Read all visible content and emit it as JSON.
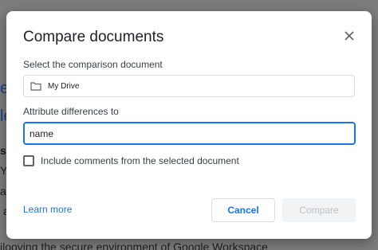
{
  "backdrop": {
    "fragments": [
      "e",
      "le",
      "s",
      "Y",
      "ap",
      "a",
      "ilooving the secure environment of Google Workspace"
    ]
  },
  "dialog": {
    "title": "Compare documents",
    "select_label": "Select the comparison document",
    "selected_document": "My Drive",
    "attribute_label": "Attribute differences to",
    "attribute_value": "name",
    "include_comments_label": "Include comments from the selected document",
    "include_comments_checked": false,
    "learn_more": "Learn more",
    "cancel_label": "Cancel",
    "compare_label": "Compare",
    "compare_enabled": false
  },
  "colors": {
    "accent": "#1a73e8",
    "disabled_text": "#bdc1c6",
    "overlay": "#7d7d7d"
  },
  "icons": {
    "close": "close-icon",
    "folder": "folder-icon"
  }
}
